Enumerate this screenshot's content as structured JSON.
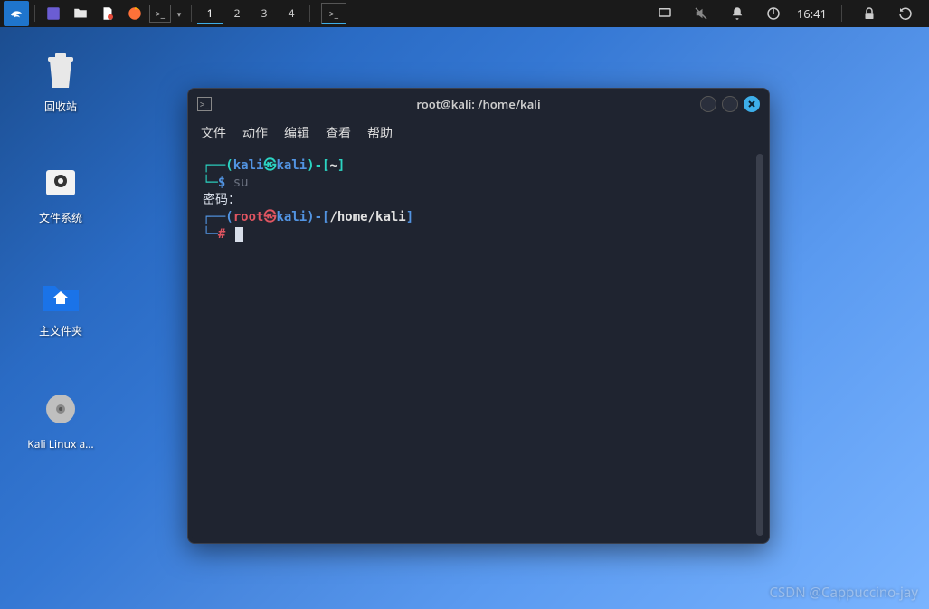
{
  "panel": {
    "workspaces": [
      "1",
      "2",
      "3",
      "4"
    ],
    "active_workspace": 0,
    "clock": "16:41"
  },
  "desktop": {
    "trash": "回收站",
    "filesystem": "文件系统",
    "home": "主文件夹",
    "kali_app": "Kali Linux a…"
  },
  "terminal": {
    "title": "root@kali: /home/kali",
    "menu": {
      "file": "文件",
      "actions": "动作",
      "edit": "编辑",
      "view": "查看",
      "help": "帮助"
    },
    "prompt1": {
      "open": "┌──(",
      "user": "kali",
      "at": "㉿",
      "host": "kali",
      "close": ")-[",
      "path": "~",
      "end": "]"
    },
    "line1": {
      "lead": "└─",
      "ps": "$ ",
      "cmd": "su"
    },
    "pwd_label": "密码：",
    "prompt2": {
      "open": "┌──(",
      "user": "root",
      "at": "㉿",
      "host": "kali",
      "close": ")-[",
      "path": "/home/kali",
      "end": "]"
    },
    "line2": {
      "lead": "└─",
      "ps": "# "
    }
  },
  "watermark": "CSDN @Cappuccino-jay"
}
